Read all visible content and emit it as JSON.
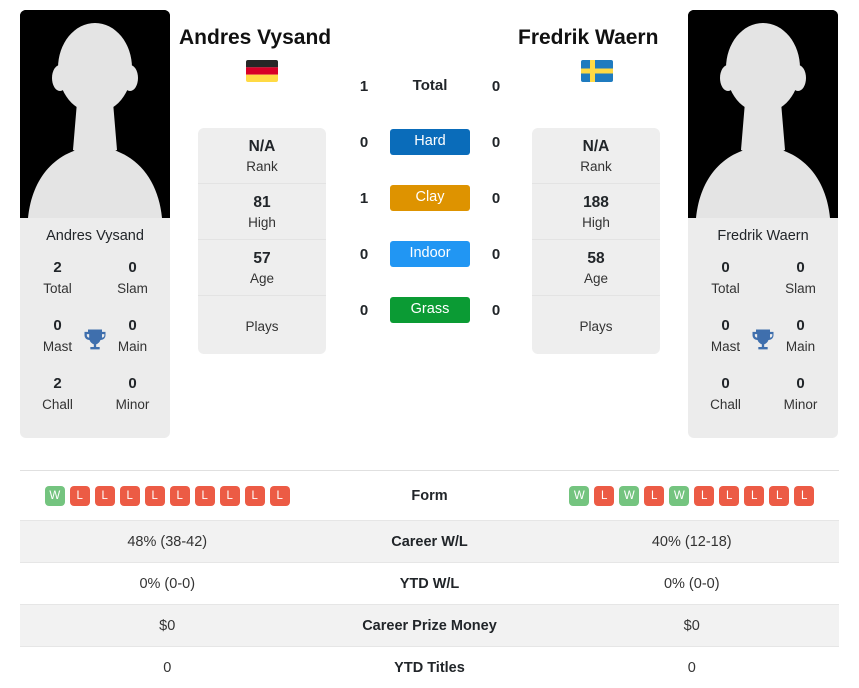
{
  "players": {
    "left": {
      "name": "Andres Vysand",
      "card_name": "Andres Vysand",
      "country": "germany-flag",
      "rank": "N/A",
      "rank_label": "Rank",
      "high": "81",
      "high_label": "High",
      "age": "57",
      "age_label": "Age",
      "plays": "",
      "plays_label": "Plays",
      "titles": {
        "total": "2",
        "total_label": "Total",
        "slam": "0",
        "slam_label": "Slam",
        "mast": "0",
        "mast_label": "Mast",
        "main": "0",
        "main_label": "Main",
        "chall": "2",
        "chall_label": "Chall",
        "minor": "0",
        "minor_label": "Minor"
      },
      "form": [
        "W",
        "L",
        "L",
        "L",
        "L",
        "L",
        "L",
        "L",
        "L",
        "L"
      ],
      "career_wl": "48% (38-42)",
      "ytd_wl": "0% (0-0)",
      "career_prize_money": "$0",
      "ytd_titles": "0"
    },
    "right": {
      "name": "Fredrik Waern",
      "card_name": "Fredrik Waern",
      "country": "sweden-flag",
      "rank": "N/A",
      "rank_label": "Rank",
      "high": "188",
      "high_label": "High",
      "age": "58",
      "age_label": "Age",
      "plays": "",
      "plays_label": "Plays",
      "titles": {
        "total": "0",
        "total_label": "Total",
        "slam": "0",
        "slam_label": "Slam",
        "mast": "0",
        "mast_label": "Mast",
        "main": "0",
        "main_label": "Main",
        "chall": "0",
        "chall_label": "Chall",
        "minor": "0",
        "minor_label": "Minor"
      },
      "form": [
        "W",
        "L",
        "W",
        "L",
        "W",
        "L",
        "L",
        "L",
        "L",
        "L"
      ],
      "career_wl": "40% (12-18)",
      "ytd_wl": "0% (0-0)",
      "career_prize_money": "$0",
      "ytd_titles": "0"
    }
  },
  "h2h": [
    {
      "left": "1",
      "label": "Total",
      "right": "0",
      "type": "text"
    },
    {
      "left": "0",
      "label": "Hard",
      "right": "0",
      "type": "badge",
      "color": "#0a6cba"
    },
    {
      "left": "1",
      "label": "Clay",
      "right": "0",
      "type": "badge",
      "color": "#de9300"
    },
    {
      "left": "0",
      "label": "Indoor",
      "right": "0",
      "type": "badge",
      "color": "#2196f3"
    },
    {
      "left": "0",
      "label": "Grass",
      "right": "0",
      "type": "badge",
      "color": "#0b9b34"
    }
  ],
  "comparison_rows": [
    {
      "label": "Form",
      "left": "",
      "right": ""
    },
    {
      "label": "Career W/L",
      "left": "48% (38-42)",
      "right": "40% (12-18)"
    },
    {
      "label": "YTD W/L",
      "left": "0% (0-0)",
      "right": "0% (0-0)"
    },
    {
      "label": "Career Prize Money",
      "left": "$0",
      "right": "$0"
    },
    {
      "label": "YTD Titles",
      "left": "0",
      "right": "0"
    }
  ],
  "icons": {
    "trophy": "trophy-icon"
  },
  "colors": {
    "win": "#74c47f",
    "loss": "#ec5b45",
    "hard": "#0a6cba",
    "clay": "#de9300",
    "indoor": "#2196f3",
    "grass": "#0b9b34",
    "trophy": "#3f6fad",
    "panel_bg": "#ececec",
    "row_alt_bg": "#f2f2f2"
  }
}
